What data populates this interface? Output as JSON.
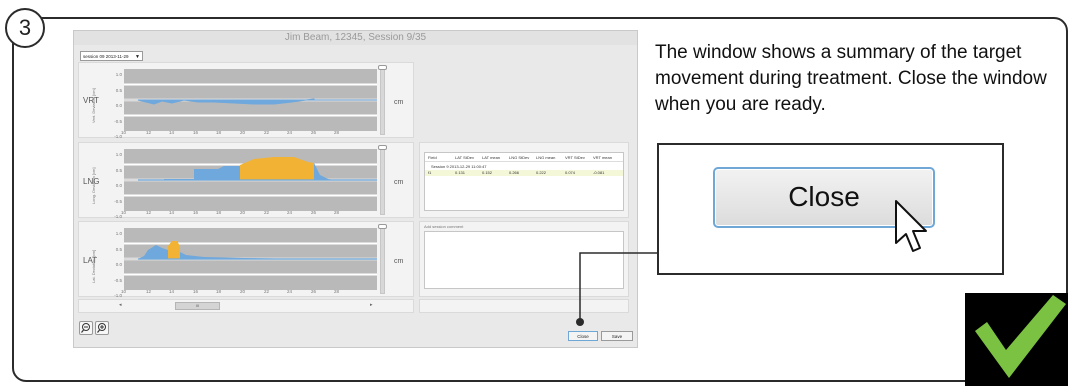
{
  "step_number": "3",
  "window": {
    "title": "Jim Beam, 12345, Session 9/35",
    "session_select": "session 09 2013-11-29",
    "panels": [
      {
        "label": "VRT",
        "unit": "cm",
        "ylabel": "Vert. Deviation [cm]",
        "yticks": [
          "1.0",
          "0.5",
          "0.0",
          "-0.5",
          "-1.0"
        ]
      },
      {
        "label": "LNG",
        "unit": "cm",
        "ylabel": "Long. Deviation [cm]",
        "yticks": [
          "1.0",
          "0.5",
          "0.0",
          "-0.5",
          "-1.0"
        ]
      },
      {
        "label": "LAT",
        "unit": "cm",
        "ylabel": "Lat. Deviation [cm]",
        "yticks": [
          "1.0",
          "0.5",
          "0.0",
          "-0.5",
          "-1.0"
        ]
      }
    ],
    "xticks": [
      "10",
      "12",
      "14",
      "16",
      "18",
      "20",
      "22",
      "24",
      "26",
      "28"
    ],
    "table": {
      "headers": [
        "Field",
        "LAT StDev",
        "LAT mean",
        "LNG StDev",
        "LNG mean",
        "VRT StDev",
        "VRT mean"
      ],
      "group": "Session 9 2013-12-29 11:00:47",
      "rows": [
        [
          "f1",
          "0.131",
          "0.152",
          "0.266",
          "0.222",
          "0.074",
          "-0.081"
        ]
      ]
    },
    "comment_placeholder": "Add session comment",
    "scroll_grip": "III",
    "zoom_out_icon": "zoom-out-icon",
    "zoom_in_icon": "zoom-in-icon",
    "buttons": {
      "close": "Close",
      "save": "Save"
    },
    "colors": {
      "trace": "#6fa8dc",
      "highlight": "#f2b234",
      "plot_bg": "#b9b9b9"
    }
  },
  "instruction": "The window shows a summary of the target movement during treatment. Close the window when you are ready.",
  "zoom": {
    "close_label": "Close"
  },
  "check_color": "#7cc242"
}
